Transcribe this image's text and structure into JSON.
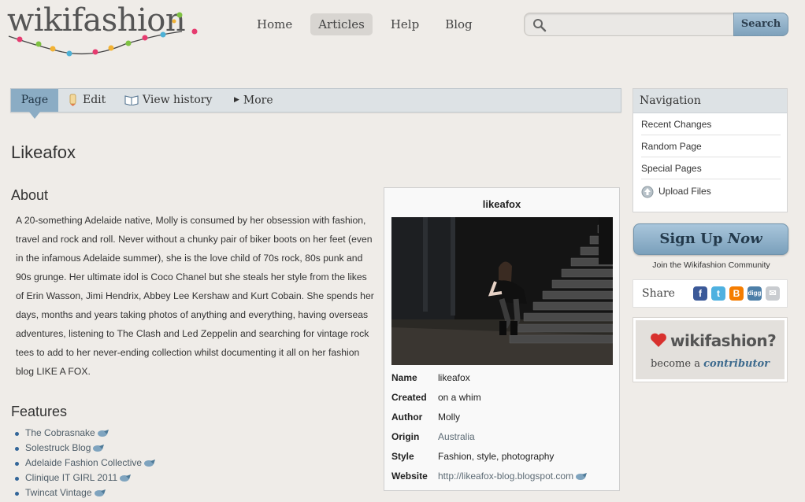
{
  "header": {
    "logo_text": "wikifashion",
    "nav": [
      {
        "label": "Home",
        "active": false
      },
      {
        "label": "Articles",
        "active": true
      },
      {
        "label": "Help",
        "active": false
      },
      {
        "label": "Blog",
        "active": false
      }
    ],
    "search": {
      "placeholder": "",
      "button_label": "Search"
    }
  },
  "tabs": {
    "page": "Page",
    "edit": "Edit",
    "history": "View history",
    "more": "More"
  },
  "article": {
    "title": "Likeafox",
    "about_heading": "About",
    "about_text": "A 20-something Adelaide native, Molly is consumed by her obsession with fashion, travel and rock and roll. Never without a chunky pair of biker boots on her feet (even in the infamous Adelaide summer), she is the love child of 70s rock, 80s punk and 90s grunge. Her ultimate idol is Coco Chanel but she steals her style from the likes of Erin Wasson, Jimi Hendrix, Abbey Lee Kershaw and Kurt Cobain. She spends her days, months and years taking photos of anything and everything, having overseas adventures, listening to The Clash and Led Zeppelin and searching for vintage rock tees to add to her never-ending collection whilst documenting it all on her fashion blog LIKE A FOX.",
    "features_heading": "Features",
    "features": [
      "The Cobrasnake",
      "Solestruck Blog",
      "Adelaide Fashion Collective",
      "Clinique IT GIRL 2011",
      "Twincat Vintage"
    ]
  },
  "infobox": {
    "title": "likeafox",
    "rows": [
      {
        "key": "Name",
        "value": "likeafox"
      },
      {
        "key": "Created",
        "value": "on a whim"
      },
      {
        "key": "Author",
        "value": "Molly"
      },
      {
        "key": "Origin",
        "value": "Australia"
      },
      {
        "key": "Style",
        "value": "Fashion, style, photography"
      },
      {
        "key": "Website",
        "value": "http://likeafox-blog.blogspot.com"
      }
    ]
  },
  "sidebar": {
    "nav_heading": "Navigation",
    "nav_items": [
      "Recent Changes",
      "Random Page",
      "Special Pages",
      "Upload Files"
    ],
    "signup_label": "Sign Up",
    "signup_label_em": "Now",
    "join_text": "Join the Wikifashion Community",
    "share_label": "Share",
    "share_icons": [
      "facebook-icon",
      "twitter-icon",
      "blogger-icon",
      "digg-icon",
      "email-icon"
    ],
    "contrib_title": "wikifashion?",
    "contrib_sub": "become a",
    "contrib_link": "contributor"
  },
  "colors": {
    "background": "#efece8",
    "accent_blue": "#8bacc4",
    "tab_bar": "#dde2e5",
    "link_blue": "#336699"
  }
}
